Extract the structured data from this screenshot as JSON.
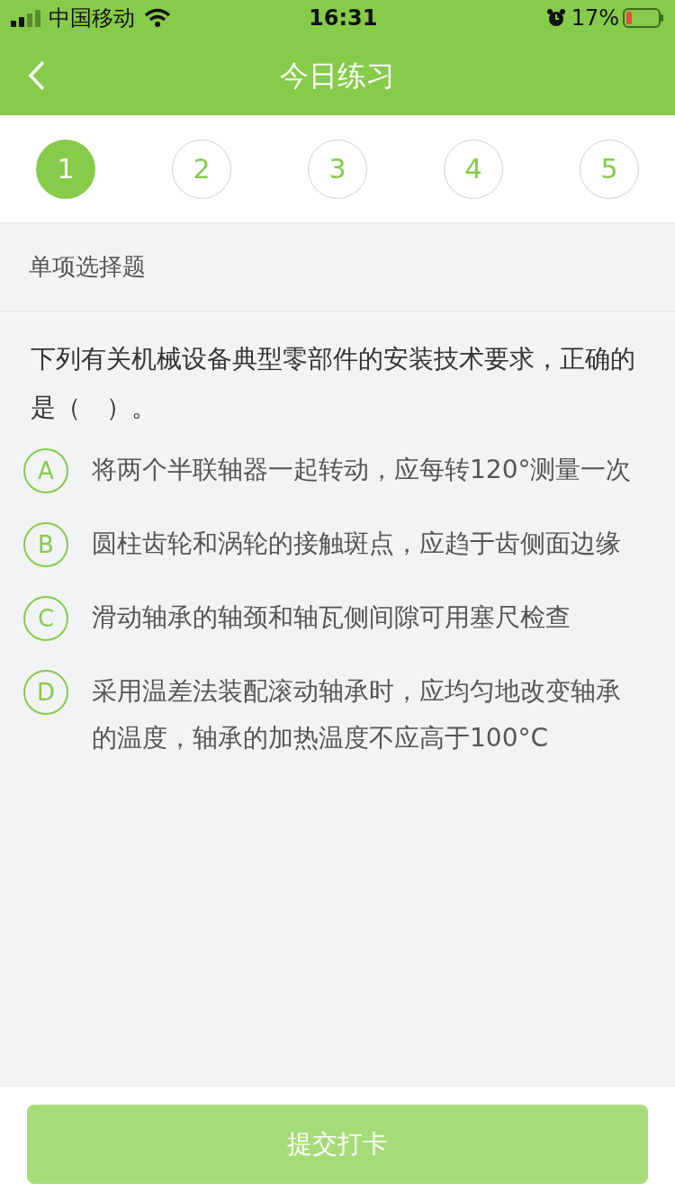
{
  "status_bar": {
    "carrier": "中国移动",
    "time": "16:31",
    "battery": "17%"
  },
  "nav": {
    "title": "今日练习"
  },
  "steps": [
    {
      "label": "1",
      "selected": true
    },
    {
      "label": "2",
      "selected": false
    },
    {
      "label": "3",
      "selected": false
    },
    {
      "label": "4",
      "selected": false
    },
    {
      "label": "5",
      "selected": false
    }
  ],
  "question": {
    "type": "单项选择题",
    "text": "下列有关机械设备典型零部件的安装技术要求，正确的是（　）。",
    "options": [
      {
        "letter": "A",
        "text": "将两个半联轴器一起转动，应每转120°测量一次",
        "selected": false
      },
      {
        "letter": "B",
        "text": "圆柱齿轮和涡轮的接触斑点，应趋于齿侧面边缘",
        "selected": false
      },
      {
        "letter": "C",
        "text": "滑动轴承的轴颈和轴瓦侧间隙可用塞尺检查",
        "selected": false
      },
      {
        "letter": "D",
        "text": "采用温差法装配滚动轴承时，应均匀地改变轴承的温度，轴承的加热温度不应高于100°C",
        "selected": false
      }
    ]
  },
  "submit": {
    "label": "提交打卡",
    "disabled": true
  }
}
